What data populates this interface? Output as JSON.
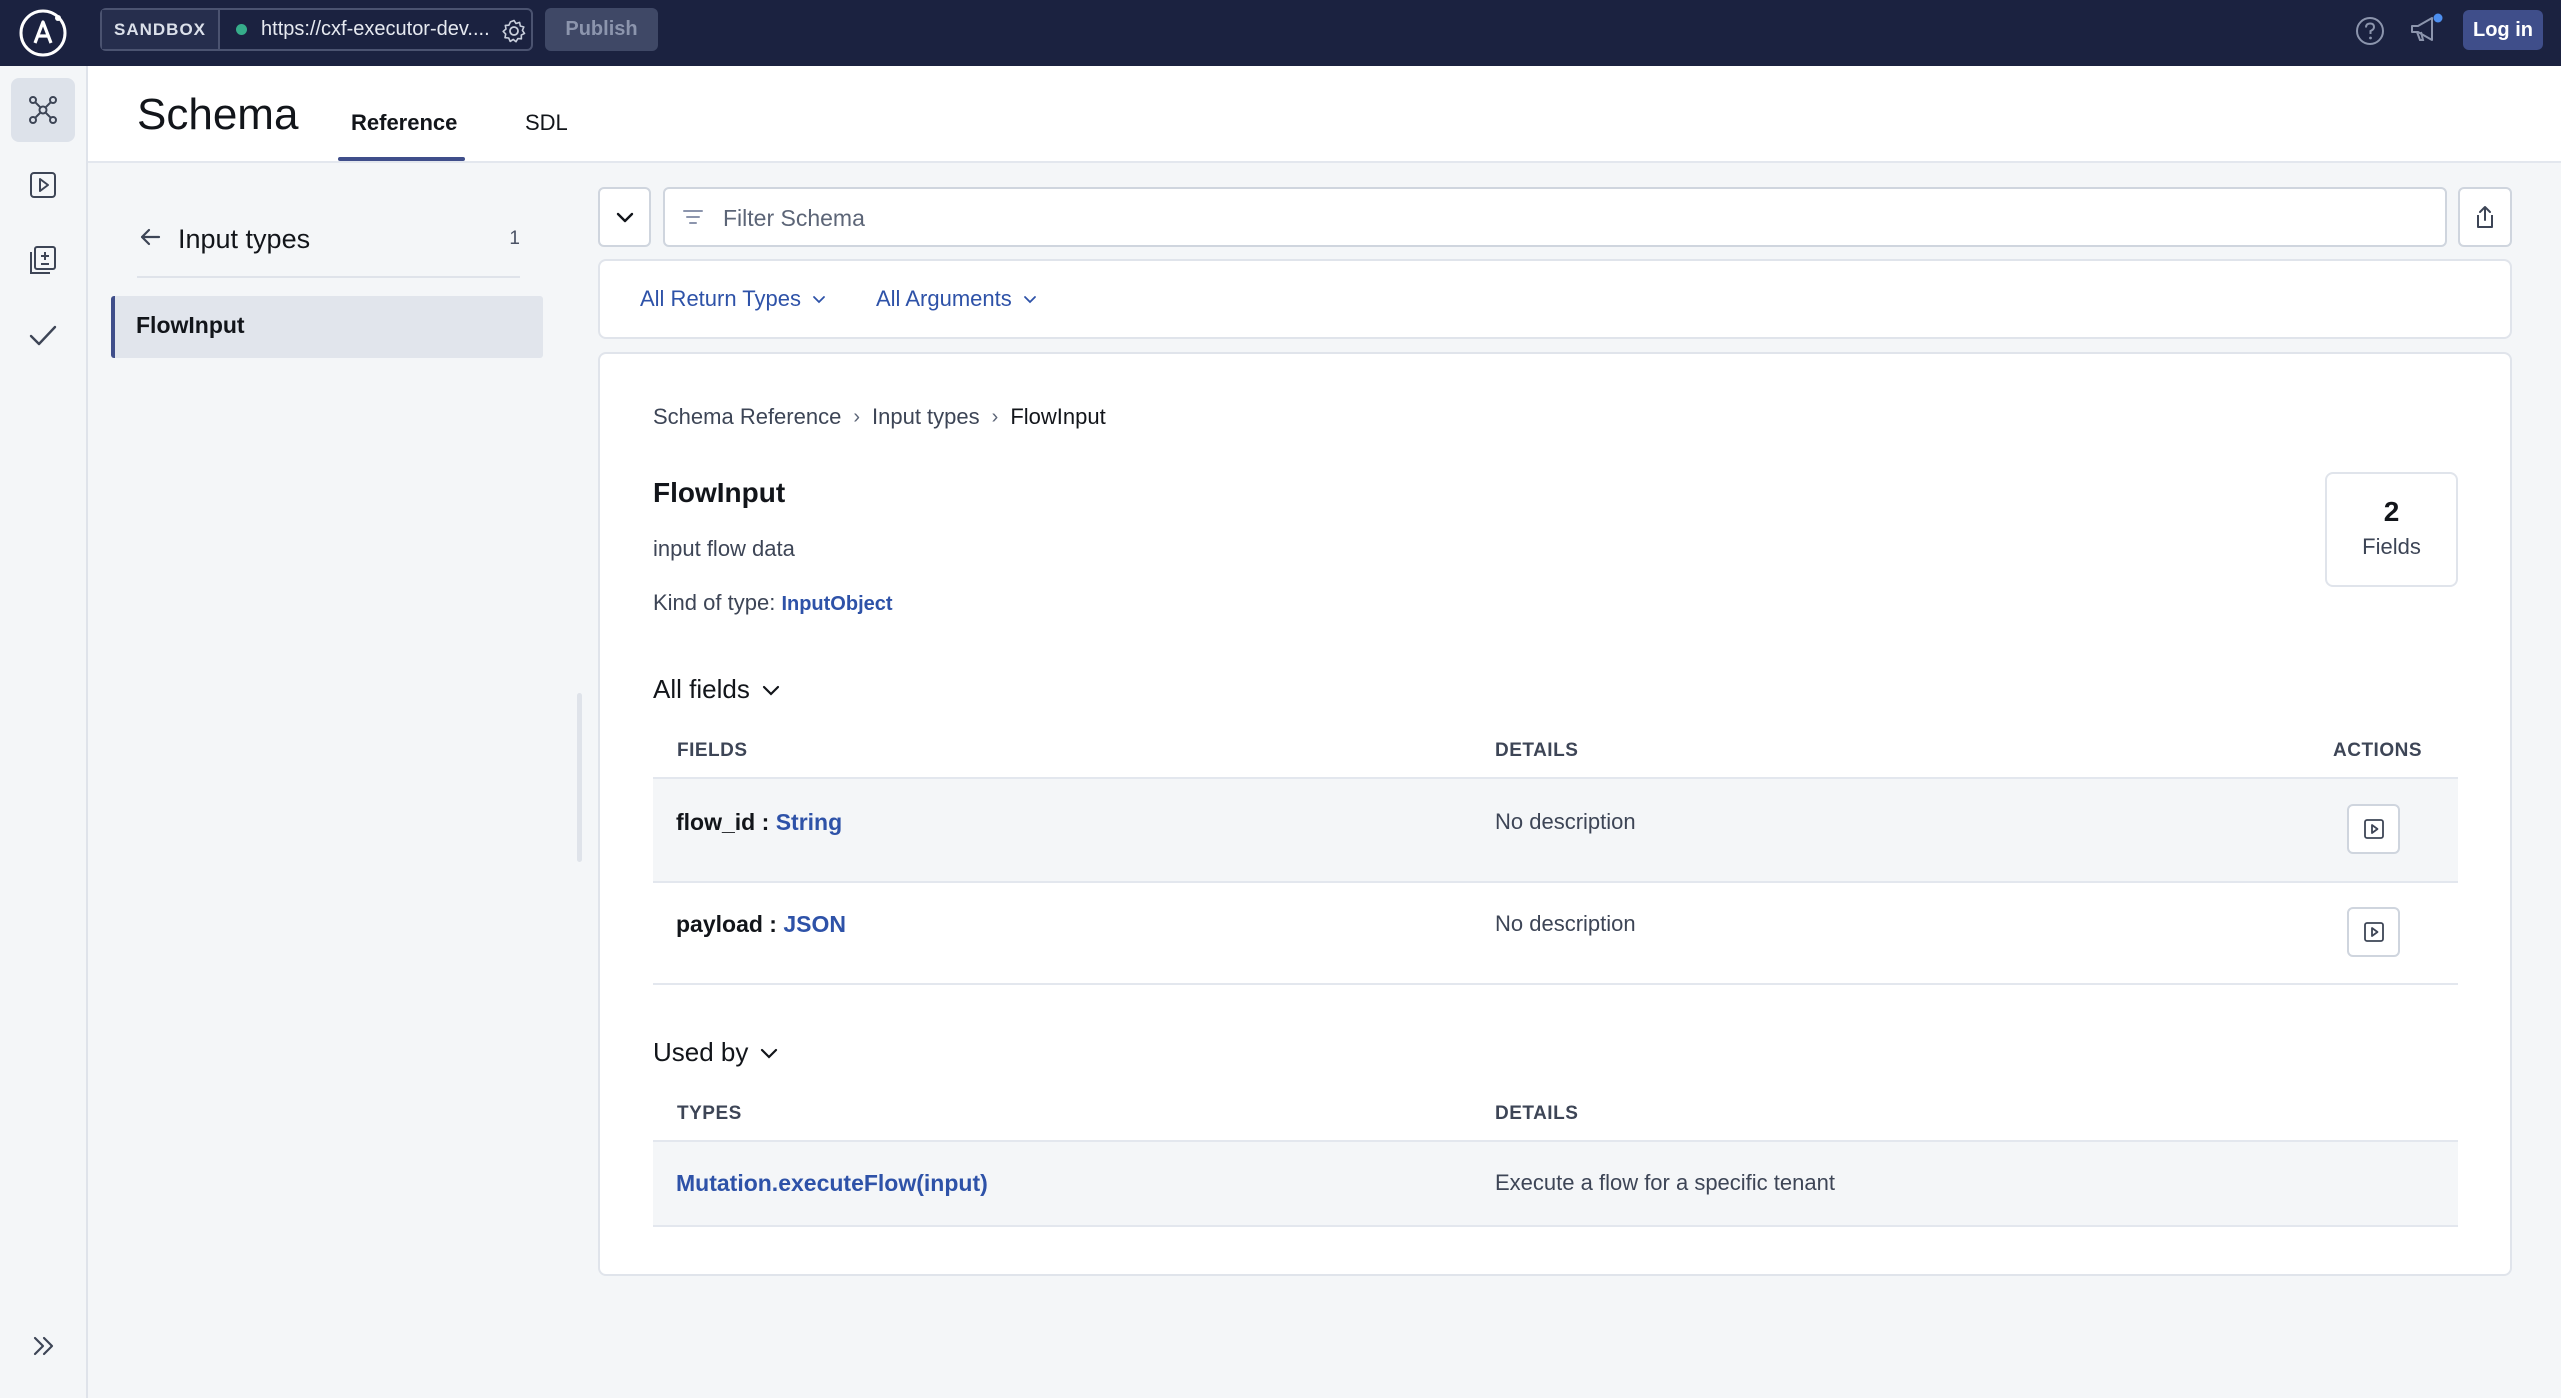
{
  "topbar": {
    "sandbox_label": "SANDBOX",
    "endpoint_url": "https://cxf-executor-dev....",
    "publish_label": "Publish",
    "login_label": "Log in",
    "accent_color": "#1b2240"
  },
  "rail": {
    "items": [
      "schema-icon",
      "explorer-icon",
      "changelog-icon",
      "checks-icon"
    ],
    "expand_icon": "double-chevron-right-icon"
  },
  "header": {
    "title": "Schema",
    "tabs": [
      {
        "label": "Reference",
        "active": true
      },
      {
        "label": "SDL",
        "active": false
      }
    ]
  },
  "left_panel": {
    "title": "Input types",
    "count": "1",
    "items": [
      {
        "label": "FlowInput",
        "selected": true
      }
    ]
  },
  "filter": {
    "placeholder": "Filter Schema",
    "value": ""
  },
  "dropdowns": {
    "return_types": "All Return Types",
    "arguments": "All Arguments"
  },
  "detail": {
    "breadcrumb": [
      "Schema Reference",
      "Input types",
      "FlowInput"
    ],
    "type_name": "FlowInput",
    "description": "input flow data",
    "kind_label": "Kind of type:",
    "kind_value": "InputObject",
    "fields_count": "2",
    "fields_count_label": "Fields",
    "fields_section": {
      "title": "All fields",
      "headers": {
        "fields": "FIELDS",
        "details": "DETAILS",
        "actions": "ACTIONS"
      },
      "rows": [
        {
          "name": "flow_id",
          "sep": " : ",
          "type": "String",
          "details": "No description"
        },
        {
          "name": "payload",
          "sep": " : ",
          "type": "JSON",
          "details": "No description"
        }
      ]
    },
    "used_by_section": {
      "title": "Used by",
      "headers": {
        "types": "TYPES",
        "details": "DETAILS"
      },
      "rows": [
        {
          "type": "Mutation.executeFlow(input)",
          "details": "Execute a flow for a specific tenant"
        }
      ]
    }
  },
  "colors": {
    "link": "#2e52a8",
    "brand": "#3f4e8a",
    "status_dot": "#36ad8a"
  }
}
